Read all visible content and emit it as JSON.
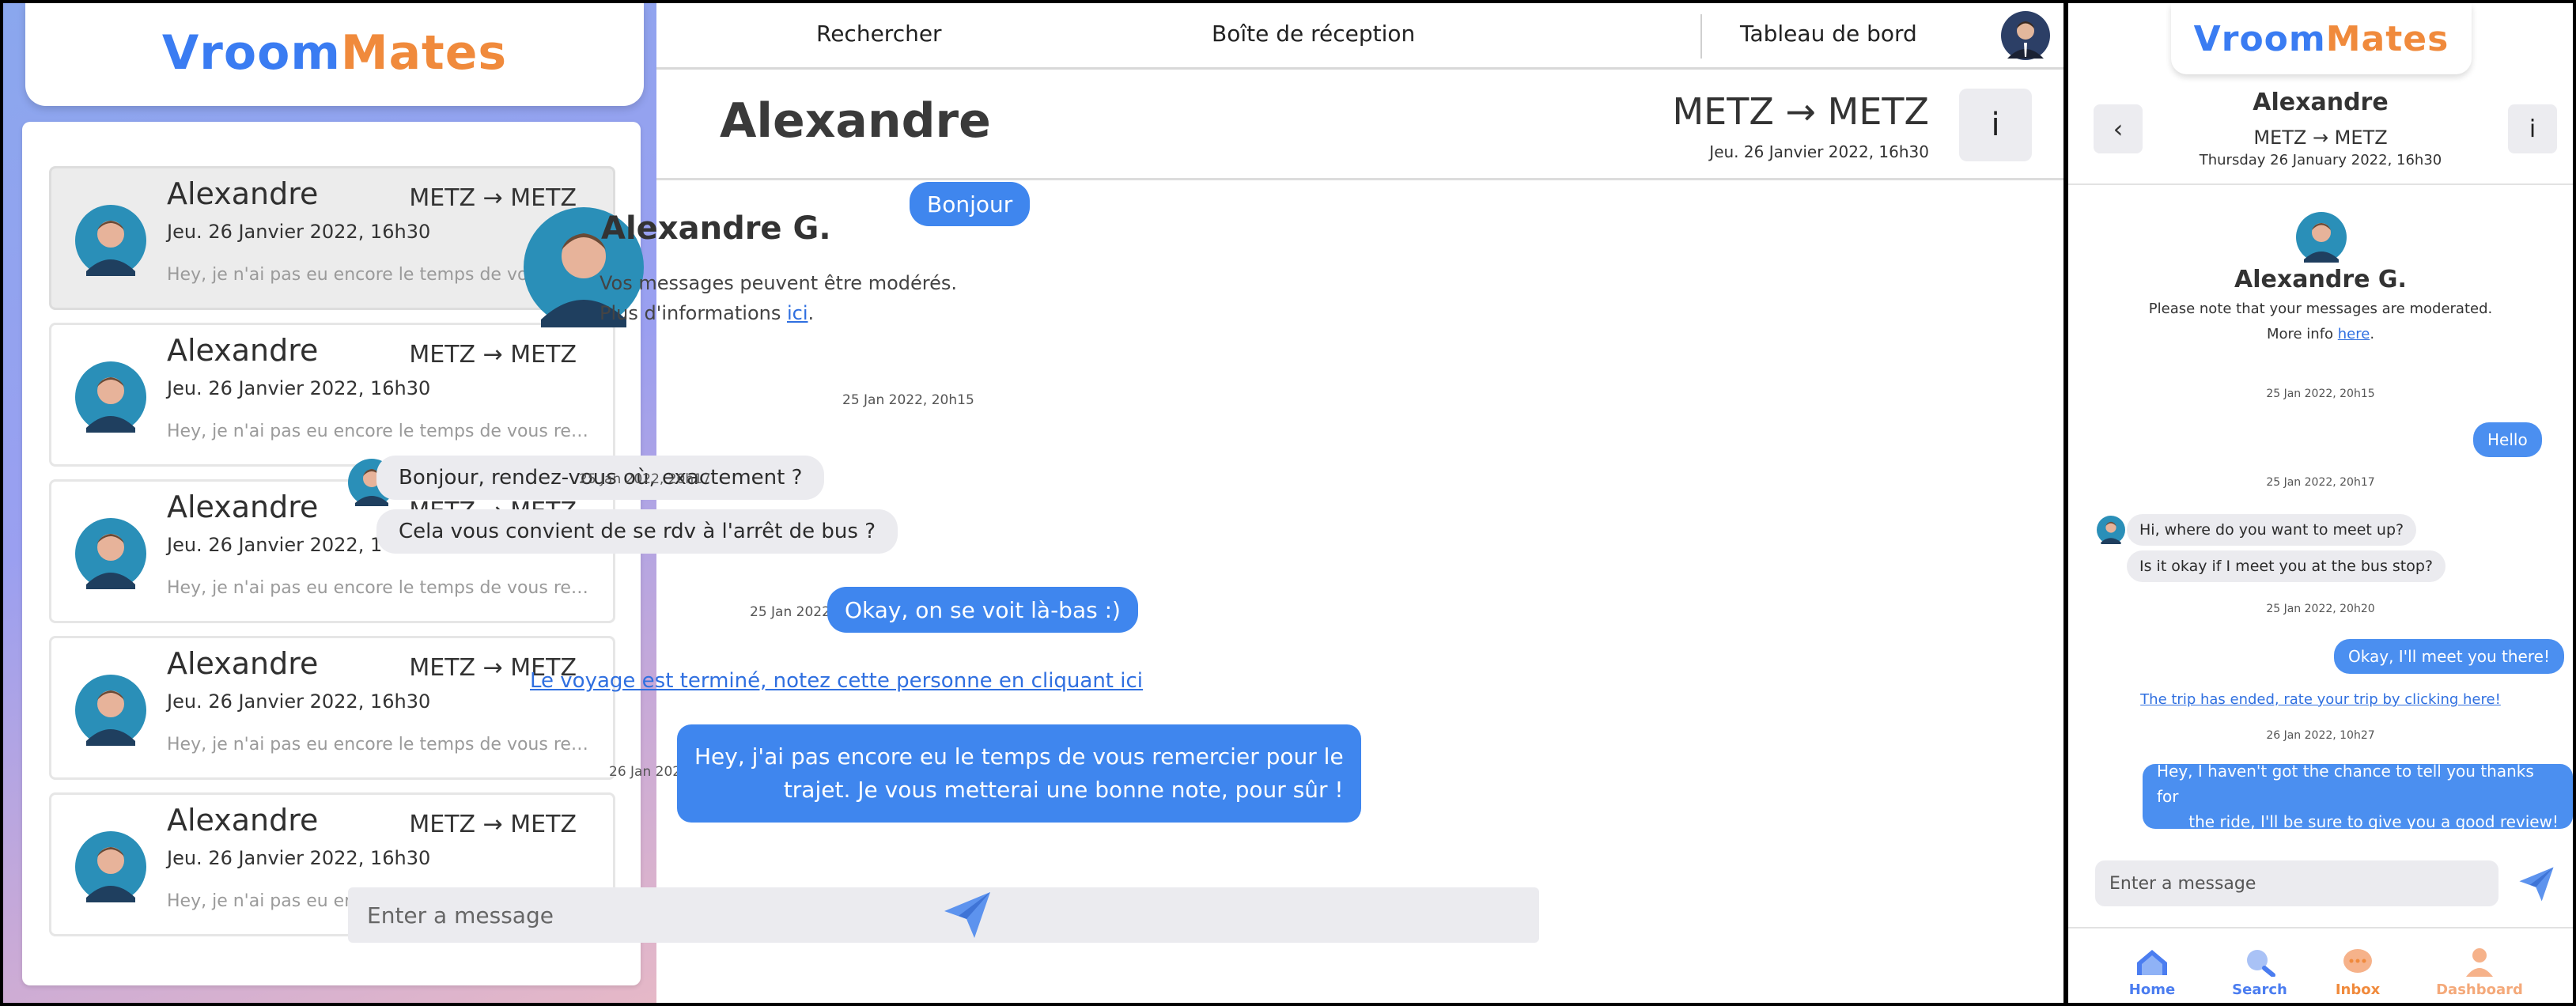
{
  "brand": {
    "logo_part1": "Vr",
    "logo_part2": "oo",
    "logo_part3": "m",
    "logo_part4": "Mates",
    "color_blue": "#3a7cf2",
    "color_orange": "#f08a3c"
  },
  "nav": {
    "search": "Rechercher",
    "inbox": "Boîte de réception",
    "dashboard": "Tableau de bord"
  },
  "conversations": [
    {
      "name": "Alexandre",
      "route": "METZ → METZ",
      "date": "Jeu. 26 Janvier 2022, 16h30",
      "preview": "Hey, je n'ai pas eu encore le temps de vous remerci..."
    },
    {
      "name": "Alexandre",
      "route": "METZ → METZ",
      "date": "Jeu. 26 Janvier 2022, 16h30",
      "preview": "Hey, je n'ai pas eu encore le temps de vous remerci..."
    },
    {
      "name": "Alexandre",
      "route": "METZ → METZ",
      "date": "Jeu. 26 Janvier 2022, 16h30",
      "preview": "Hey, je n'ai pas eu encore le temps de vous remerci..."
    },
    {
      "name": "Alexandre",
      "route": "METZ → METZ",
      "date": "Jeu. 26 Janvier 2022, 16h30",
      "preview": "Hey, je n'ai pas eu encore le temps de vous remerci..."
    },
    {
      "name": "Alexandre",
      "route": "METZ → METZ",
      "date": "Jeu. 26 Janvier 2022, 16h30",
      "preview": "Hey, je n'ai pas eu encore le temps de vous remerci..."
    }
  ],
  "chat": {
    "title": "Alexandre",
    "route": "METZ → METZ",
    "date": "Jeu. 26 Janvier 2022, 16h30",
    "info_label": "i",
    "profile_name": "Alexandre G.",
    "note1": "Vos messages peuvent être modérés.",
    "note2_prefix": "Plus d'informations ",
    "note2_link": "ici",
    "note2_suffix": ".",
    "messages": {
      "m1": {
        "text": "Bonjour",
        "time": "25 Jan 2022, 20h15"
      },
      "m2": {
        "text": "Bonjour, rendez-vous où, exactement ?",
        "time": "25 Jan 2022, 20h17"
      },
      "m3": {
        "text": "Cela vous convient de se rdv à l'arrêt de bus ?"
      },
      "m4": {
        "text": "Okay, on se voit là-bas :)",
        "time": "25 Jan 2022, 20h20"
      },
      "m5": {
        "line1": "Hey, j'ai pas encore eu le temps de vous remercier pour le",
        "line2": "trajet. Je vous metterai une bonne note, pour sûr !",
        "time": "26 Jan 2022, 18h27"
      }
    },
    "end_link": "Le voyage est terminé, notez cette personne en cliquant ici",
    "input_placeholder": "Enter a message"
  },
  "mobile": {
    "back_label": "‹",
    "info_label": "i",
    "name": "Alexandre",
    "route": "METZ → METZ",
    "date": "Thursday 26 January 2022, 16h30",
    "profile_name": "Alexandre G.",
    "note1": "Please note that your messages are moderated.",
    "note2_prefix": "More info ",
    "note2_link": "here",
    "note2_suffix": ".",
    "messages": {
      "t1": "25 Jan 2022, 20h15",
      "m1": "Hello",
      "t2": "25 Jan 2022, 20h17",
      "m2": "Hi, where do you want to meet up?",
      "m3": "Is it okay if I meet you at the bus stop?",
      "t3": "25 Jan 2022, 20h20",
      "m4": "Okay, I'll meet you there!",
      "t4": "26 Jan 2022, 10h27",
      "m5_line1": "Hey, I haven't got the chance to tell you thanks for",
      "m5_line2": "the ride, I'll be sure to give you a good review!"
    },
    "end_link": "The trip has ended, rate your trip by clicking here!",
    "input_placeholder": "Enter a message",
    "tabs": [
      {
        "label": "Home",
        "icon": "home-icon",
        "color": "#4b7df0"
      },
      {
        "label": "Search",
        "icon": "search-icon",
        "color": "#4b7df0"
      },
      {
        "label": "Inbox",
        "icon": "inbox-icon",
        "color": "#f08a3c"
      },
      {
        "label": "Dashboard",
        "icon": "user-icon",
        "color": "#f4a97a"
      }
    ]
  }
}
